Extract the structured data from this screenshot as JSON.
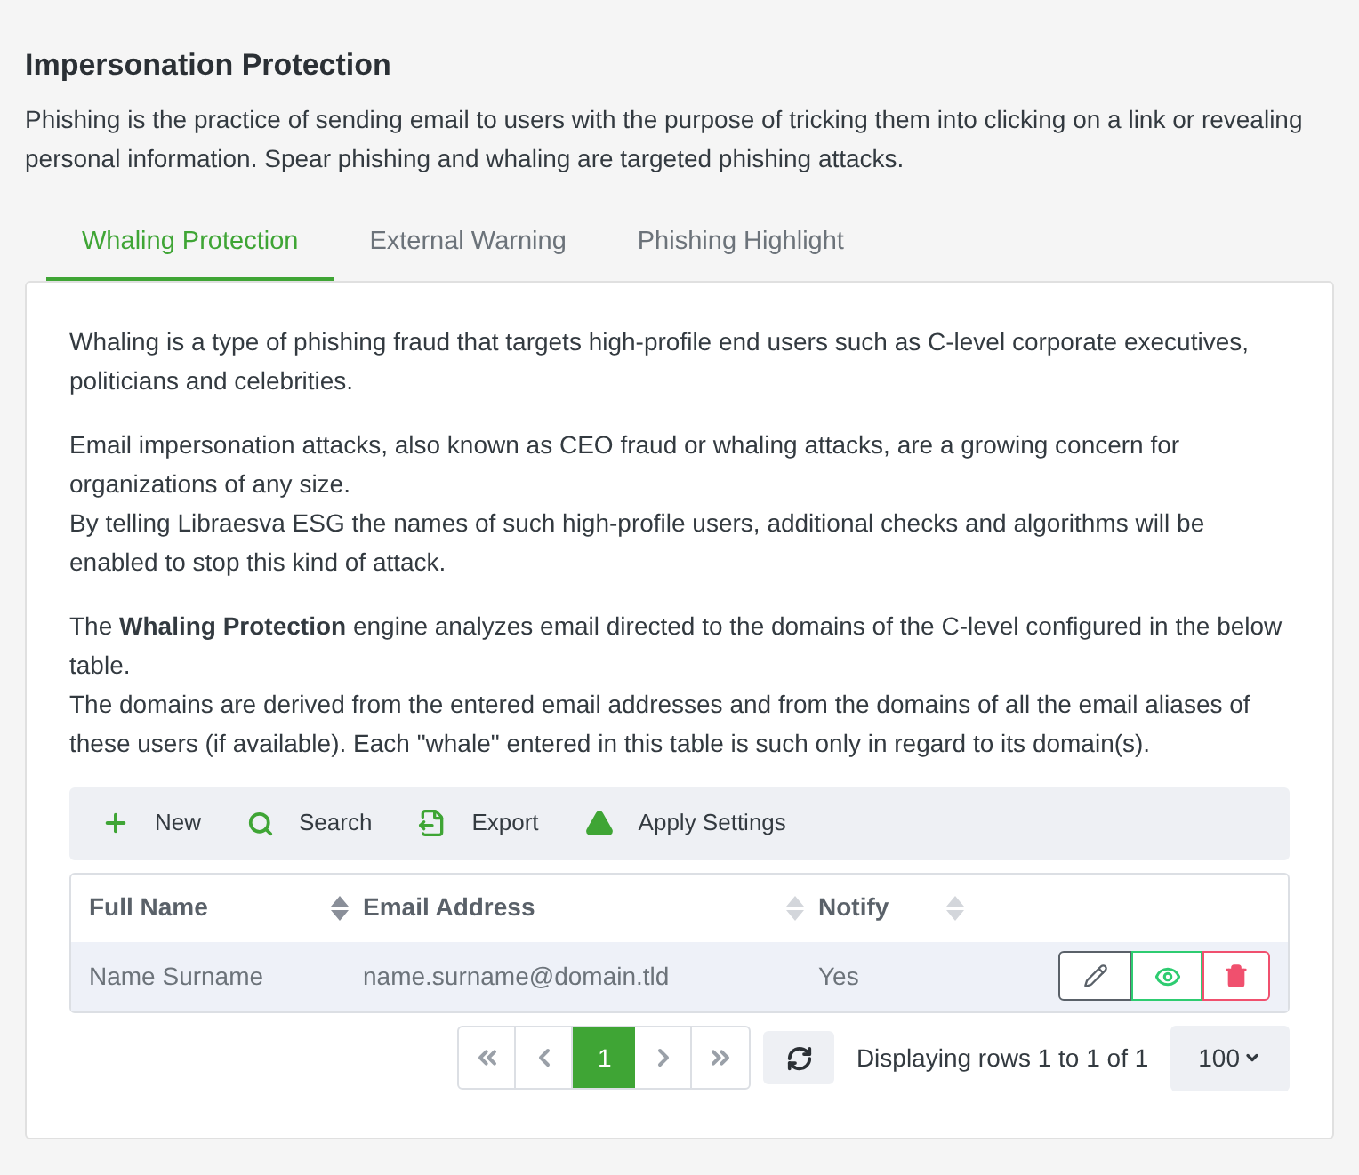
{
  "page": {
    "title": "Impersonation Protection",
    "description": "Phishing is the practice of sending email to users with the purpose of tricking them into clicking on a link or revealing personal information. Spear phishing and whaling are targeted phishing attacks."
  },
  "tabs": [
    {
      "label": "Whaling Protection",
      "selected": true
    },
    {
      "label": "External Warning",
      "selected": false
    },
    {
      "label": "Phishing Highlight",
      "selected": false
    }
  ],
  "paragraphs": [
    [
      "Whaling is a type of phishing fraud that targets high-profile end users such as C-level corporate executives, politicians and celebrities."
    ],
    [
      "Email impersonation attacks, also known as CEO fraud or whaling attacks, are a growing concern for organizations of any size.",
      "By telling Libraesva ESG the names of such high-profile users, additional checks and algorithms will be enabled to stop this kind of attack."
    ],
    [
      "The **Whaling Protection** engine analyzes email directed to the domains of the C-level configured in the below table.",
      "The domains are derived from the entered email addresses and from the domains of all the email aliases of these users (if available). Each \"whale\" entered in this table is such only in regard to its domain(s)."
    ]
  ],
  "toolbar": [
    {
      "kind": "new",
      "label": "New"
    },
    {
      "kind": "search",
      "label": "Search"
    },
    {
      "kind": "export",
      "label": "Export"
    },
    {
      "kind": "apply",
      "label": "Apply Settings"
    }
  ],
  "table": {
    "columns": [
      {
        "label": "Full Name",
        "sort_active": true
      },
      {
        "label": "Email Address",
        "sort_active": false
      },
      {
        "label": "Notify",
        "sort_active": false
      }
    ],
    "rows": [
      [
        "Name Surname",
        "name.surname@domain.tld",
        "Yes"
      ]
    ]
  },
  "pager": [
    {
      "kind": "first"
    },
    {
      "kind": "prev"
    },
    {
      "kind": "page",
      "label": "1",
      "selected": true
    },
    {
      "kind": "next"
    },
    {
      "kind": "last"
    }
  ],
  "status": "Displaying rows 1 to 1 of 1",
  "page_size": "100"
}
